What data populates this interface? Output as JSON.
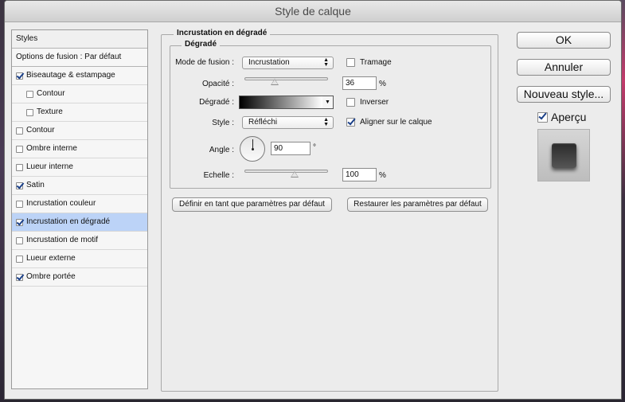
{
  "window": {
    "title": "Style de calque"
  },
  "left_panel": {
    "header": "Styles",
    "blend_options": "Options de fusion : Par défaut",
    "items": [
      {
        "label": "Biseautage & estampage",
        "checked": true,
        "indent": false,
        "selected": false
      },
      {
        "label": "Contour",
        "checked": false,
        "indent": true,
        "selected": false
      },
      {
        "label": "Texture",
        "checked": false,
        "indent": true,
        "selected": false
      },
      {
        "label": "Contour",
        "checked": false,
        "indent": false,
        "selected": false
      },
      {
        "label": "Ombre interne",
        "checked": false,
        "indent": false,
        "selected": false
      },
      {
        "label": "Lueur interne",
        "checked": false,
        "indent": false,
        "selected": false
      },
      {
        "label": "Satin",
        "checked": true,
        "indent": false,
        "selected": false
      },
      {
        "label": "Incrustation couleur",
        "checked": false,
        "indent": false,
        "selected": false
      },
      {
        "label": "Incrustation en dégradé",
        "checked": true,
        "indent": false,
        "selected": true
      },
      {
        "label": "Incrustation de motif",
        "checked": false,
        "indent": false,
        "selected": false
      },
      {
        "label": "Lueur externe",
        "checked": false,
        "indent": false,
        "selected": false
      },
      {
        "label": "Ombre portée",
        "checked": true,
        "indent": false,
        "selected": false
      }
    ]
  },
  "panel": {
    "title": "Incrustation en dégradé",
    "group": "Dégradé",
    "blend_mode": {
      "label": "Mode de fusion :",
      "value": "Incrustation"
    },
    "dither": {
      "label": "Tramage",
      "checked": false
    },
    "opacity": {
      "label": "Opacité :",
      "value": "36",
      "unit": "%",
      "level": 0.36
    },
    "gradient": {
      "label": "Dégradé :"
    },
    "reverse": {
      "label": "Inverser",
      "checked": false
    },
    "style": {
      "label": "Style :",
      "value": "Réfléchi"
    },
    "align": {
      "label": "Aligner sur le calque",
      "checked": true
    },
    "angle": {
      "label": "Angle :",
      "value": "90",
      "unit": "°"
    },
    "scale": {
      "label": "Echelle :",
      "value": "100",
      "unit": "%",
      "level": 0.6
    },
    "make_default": "Définir en tant que paramètres par défaut",
    "reset_default": "Restaurer les paramètres par défaut"
  },
  "buttons": {
    "ok": "OK",
    "cancel": "Annuler",
    "new_style": "Nouveau style...",
    "preview": {
      "label": "Aperçu",
      "checked": true
    }
  }
}
